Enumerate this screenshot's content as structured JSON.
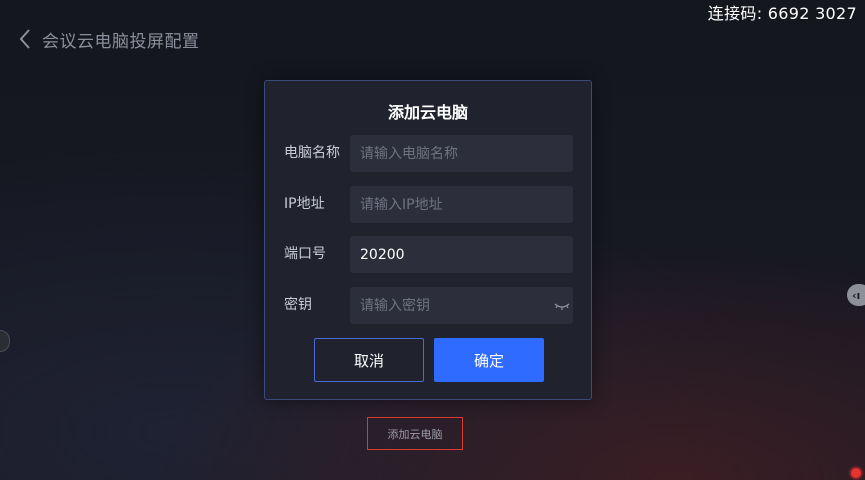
{
  "header": {
    "back_icon": "chevron-left-icon",
    "title": "会议云电脑投屏配置",
    "connection_code": "连接码: 6692 3027"
  },
  "dialog": {
    "title": "添加云电脑",
    "fields": [
      {
        "label": "电脑名称",
        "value": "",
        "placeholder": "请输入电脑名称"
      },
      {
        "label": "IP地址",
        "value": "",
        "placeholder": "请输入IP地址"
      },
      {
        "label": "端口号",
        "value": "20200",
        "placeholder": ""
      },
      {
        "label": "密钥",
        "value": "",
        "placeholder": "请输入密钥",
        "icon": "eye-closed-icon"
      }
    ],
    "cancel_label": "取消",
    "confirm_label": "确定"
  },
  "add_cloud_pc_label": "添加云电脑",
  "side_handle_label": "‹ı",
  "colors": {
    "accent": "#2f6bff",
    "highlight_border": "#d93a32",
    "recording_dot": "#e8322f"
  }
}
